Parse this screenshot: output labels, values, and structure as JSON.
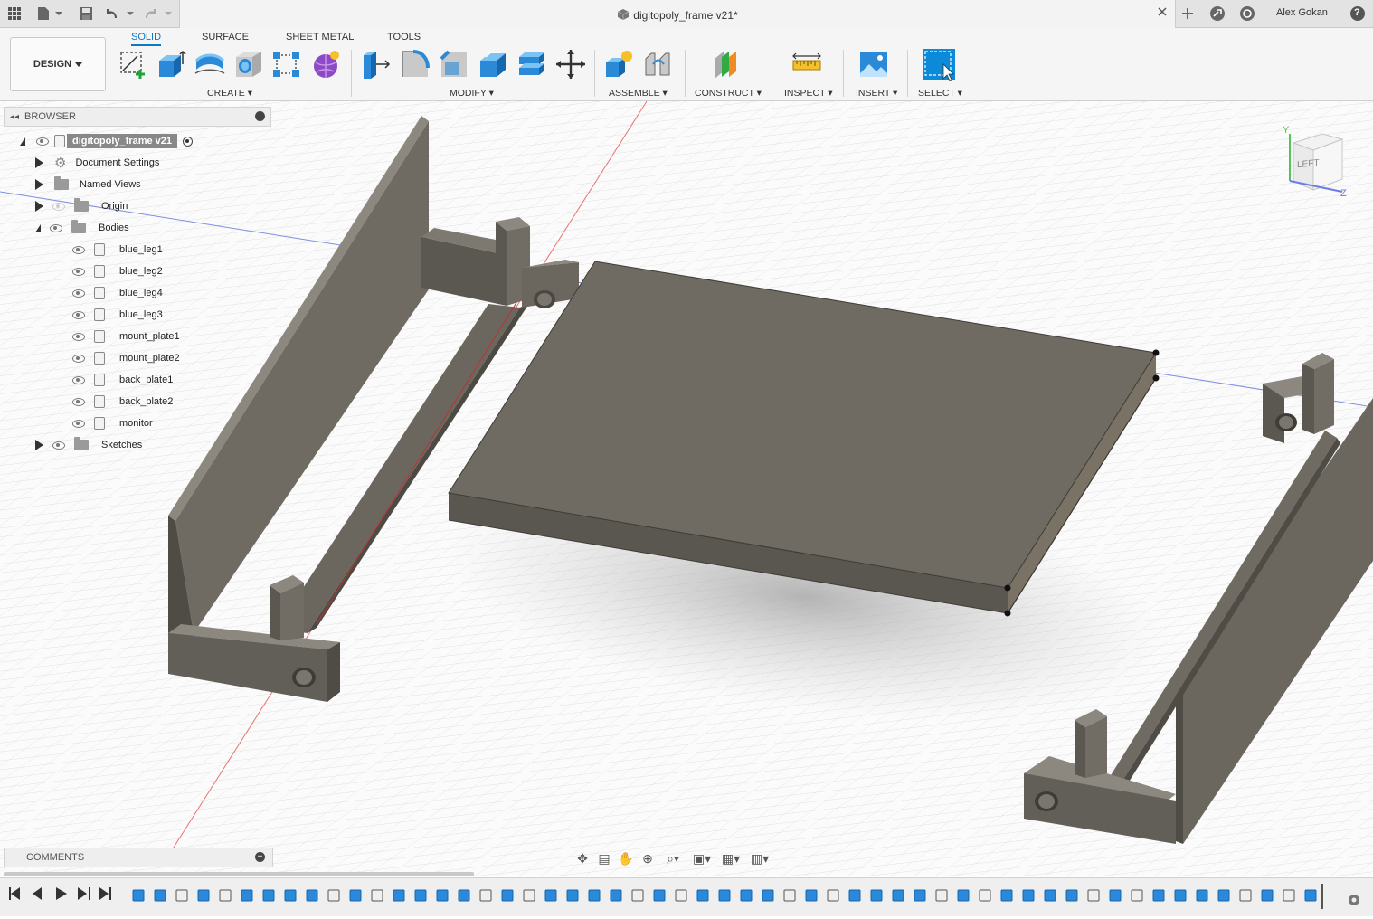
{
  "window": {
    "title": "digitopoly_frame v21*",
    "user": "Alex Gokan",
    "help": "?"
  },
  "toolbar": {
    "workspace": "DESIGN",
    "tabs": [
      "SOLID",
      "SURFACE",
      "SHEET METAL",
      "TOOLS"
    ],
    "active_tab": "SOLID",
    "groups": {
      "create": "CREATE",
      "modify": "MODIFY",
      "assemble": "ASSEMBLE",
      "construct": "CONSTRUCT",
      "inspect": "INSPECT",
      "insert": "INSERT",
      "select": "SELECT"
    }
  },
  "browser": {
    "header": "BROWSER",
    "root": "digitopoly_frame v21",
    "document_settings": "Document Settings",
    "named_views": "Named Views",
    "origin": "Origin",
    "bodies": "Bodies",
    "body_items": [
      "blue_leg1",
      "blue_leg2",
      "blue_leg4",
      "blue_leg3",
      "mount_plate1",
      "mount_plate2",
      "back_plate1",
      "back_plate2",
      "monitor"
    ],
    "sketches": "Sketches"
  },
  "comments": {
    "header": "COMMENTS"
  },
  "viewcube": {
    "face": "LEFT",
    "y_axis": "Y",
    "z_axis": "Z"
  },
  "colors": {
    "accent": "#0a77c7",
    "body": "#6e6a62",
    "body_dark": "#55524b",
    "grid": "#d9d9d9"
  }
}
